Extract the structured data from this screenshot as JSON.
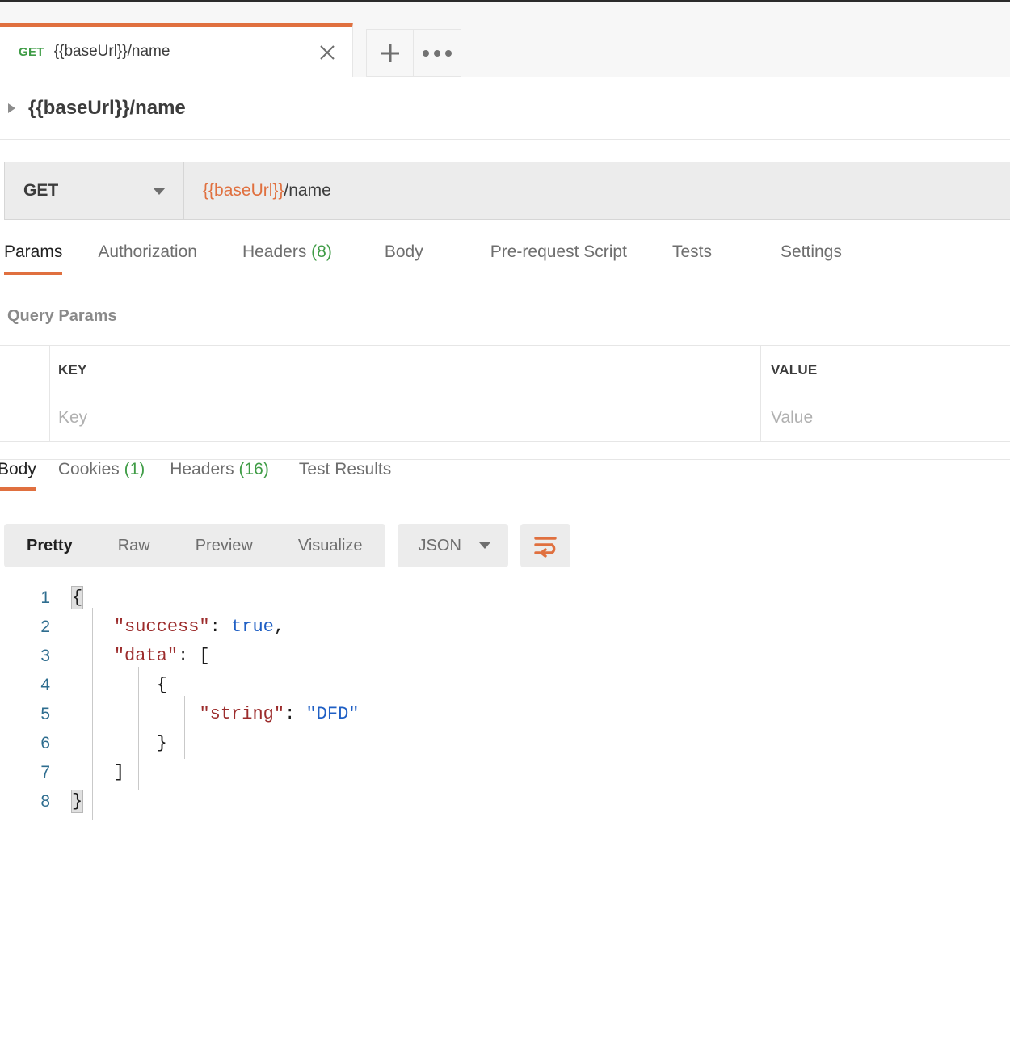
{
  "tab_bar": {
    "tabs": [
      {
        "method": "GET",
        "title": "{{baseUrl}}/name",
        "close_label": "×"
      }
    ],
    "new_tab_label": "+",
    "more_label": "•••"
  },
  "request_name": {
    "expander_icon": "caret-right-icon",
    "text": "{{baseUrl}}/name"
  },
  "url_bar": {
    "method": "GET",
    "url_variable": "{{baseUrl}}",
    "url_path": "/name",
    "url_full": "{{baseUrl}}/name"
  },
  "request_tabs": [
    {
      "label": "Params",
      "count": "",
      "active": true
    },
    {
      "label": "Authorization",
      "count": "",
      "active": false
    },
    {
      "label": "Headers",
      "count": "(8)",
      "active": false
    },
    {
      "label": "Body",
      "count": "",
      "active": false
    },
    {
      "label": "Pre-request Script",
      "count": "",
      "active": false
    },
    {
      "label": "Tests",
      "count": "",
      "active": false
    },
    {
      "label": "Settings",
      "count": "",
      "active": false
    }
  ],
  "query_params": {
    "section_title": "Query Params",
    "columns": [
      "KEY",
      "VALUE"
    ],
    "rows": [
      {
        "key_placeholder": "Key",
        "value_placeholder": "Value"
      }
    ]
  },
  "response_tabs": [
    {
      "label": "Body",
      "count": "",
      "active": true
    },
    {
      "label": "Cookies",
      "count": "(1)",
      "active": false
    },
    {
      "label": "Headers",
      "count": "(16)",
      "active": false
    },
    {
      "label": "Test Results",
      "count": "",
      "active": false
    }
  ],
  "body_toolbar": {
    "views": [
      {
        "label": "Pretty",
        "active": true
      },
      {
        "label": "Raw",
        "active": false
      },
      {
        "label": "Preview",
        "active": false
      },
      {
        "label": "Visualize",
        "active": false
      }
    ],
    "format": "JSON",
    "wrap_icon": "word-wrap-icon"
  },
  "response_body": {
    "language": "json",
    "line_numbers": [
      "1",
      "2",
      "3",
      "4",
      "5",
      "6",
      "7",
      "8"
    ],
    "raw": "{\n    \"success\": true,\n    \"data\": [\n        {\n            \"string\": \"DFD\"\n        }\n    ]\n}",
    "lines": [
      {
        "n": "1",
        "text": "{"
      },
      {
        "n": "2",
        "text": "    \"success\": true,"
      },
      {
        "n": "3",
        "text": "    \"data\": ["
      },
      {
        "n": "4",
        "text": "        {"
      },
      {
        "n": "5",
        "text": "            \"string\": \"DFD\""
      },
      {
        "n": "6",
        "text": "        }"
      },
      {
        "n": "7",
        "text": "    ]"
      },
      {
        "n": "8",
        "text": "}"
      }
    ],
    "parsed": {
      "success": true,
      "data": [
        {
          "string": "DFD"
        }
      ]
    }
  },
  "colors": {
    "accent_orange": "#e0703f",
    "method_green": "#3f9c46",
    "count_green": "#3f9c46",
    "json_key": "#9c2c2c",
    "json_value": "#1f5fc4",
    "line_number": "#2e6d8f",
    "panel_gray": "#ececec"
  }
}
